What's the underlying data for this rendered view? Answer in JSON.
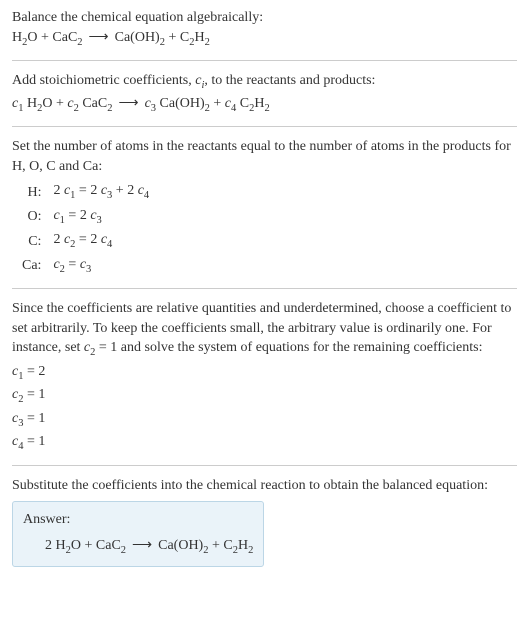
{
  "intro": {
    "line1": "Balance the chemical equation algebraically:"
  },
  "eq1": {
    "lhs1": "H",
    "lhs1s": "2",
    "lhs1b": "O",
    "plus1": " + ",
    "lhs2": "CaC",
    "lhs2s": "2",
    "arrow": "⟶",
    "rhs1": "Ca(OH)",
    "rhs1s": "2",
    "plus2": " + ",
    "rhs2": "C",
    "rhs2s": "2",
    "rhs2b": "H",
    "rhs2bs": "2"
  },
  "step2": {
    "line": "Add stoichiometric coefficients, ",
    "ci": "c",
    "cisub": "i",
    "line2": ", to the reactants and products:"
  },
  "eq2": {
    "c1": "c",
    "c1s": "1",
    "sp1": " ",
    "c2": "c",
    "c2s": "2",
    "sp2": " ",
    "c3": "c",
    "c3s": "3",
    "sp3": " ",
    "c4": "c",
    "c4s": "4",
    "sp4": " "
  },
  "step3": {
    "line": "Set the number of atoms in the reactants equal to the number of atoms in the products for H, O, C and Ca:"
  },
  "table": {
    "r1l": "H:",
    "r1e_a": "2 ",
    "r1e_b": "c",
    "r1e_bs": "1",
    "r1e_c": " = 2 ",
    "r1e_d": "c",
    "r1e_ds": "3",
    "r1e_e": " + 2 ",
    "r1e_f": "c",
    "r1e_fs": "4",
    "r2l": "O:",
    "r2e_a": "c",
    "r2e_as": "1",
    "r2e_b": " = 2 ",
    "r2e_c": "c",
    "r2e_cs": "3",
    "r3l": "C:",
    "r3e_a": "2 ",
    "r3e_b": "c",
    "r3e_bs": "2",
    "r3e_c": " = 2 ",
    "r3e_d": "c",
    "r3e_ds": "4",
    "r4l": "Ca:",
    "r4e_a": "c",
    "r4e_as": "2",
    "r4e_b": " = ",
    "r4e_c": "c",
    "r4e_cs": "3"
  },
  "step4": {
    "line_a": "Since the coefficients are relative quantities and underdetermined, choose a coefficient to set arbitrarily. To keep the coefficients small, the arbitrary value is ordinarily one. For instance, set ",
    "cv": "c",
    "cvs": "2",
    "line_b": " = 1 and solve the system of equations for the remaining coefficients:"
  },
  "coefs": {
    "l1a": "c",
    "l1as": "1",
    "l1b": " = 2",
    "l2a": "c",
    "l2as": "2",
    "l2b": " = 1",
    "l3a": "c",
    "l3as": "3",
    "l3b": " = 1",
    "l4a": "c",
    "l4as": "4",
    "l4b": " = 1"
  },
  "step5": {
    "line": "Substitute the coefficients into the chemical reaction to obtain the balanced equation:"
  },
  "answer": {
    "label": "Answer:",
    "pre": "2 "
  }
}
